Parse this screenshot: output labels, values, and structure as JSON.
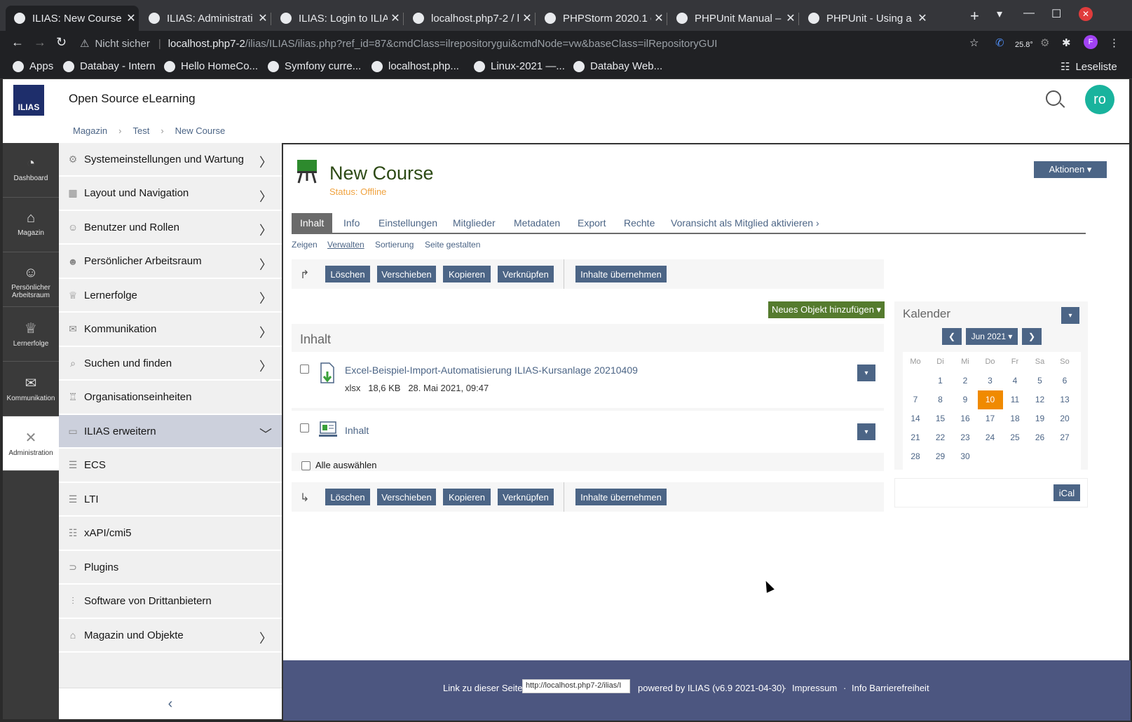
{
  "browser": {
    "tabs": [
      {
        "title": "ILIAS: New Course",
        "active": true
      },
      {
        "title": "ILIAS: Administrati",
        "active": false
      },
      {
        "title": "ILIAS: Login to ILIA",
        "active": false
      },
      {
        "title": "localhost.php7-2 / l",
        "active": false
      },
      {
        "title": "PHPStorm 2020.1 c",
        "active": false
      },
      {
        "title": "PHPUnit Manual – (",
        "active": false
      },
      {
        "title": "PHPUnit - Using a v",
        "active": false
      }
    ],
    "security_label": "Nicht sicher",
    "url_host": "localhost.php7-2",
    "url_rest": "/ilias/ILIAS/ilias.php?ref_id=87&cmdClass=ilrepositorygui&cmdNode=vw&baseClass=ilRepositoryGUI",
    "weather": "25.8°",
    "profile_initial": "F",
    "bookmarks": [
      "Apps",
      "Databay - Intern",
      "Hello HomeCo...",
      "Symfony curre...",
      "localhost.php...",
      "Linux-2021 —...",
      "Databay Web..."
    ],
    "reading_list": "Leseliste"
  },
  "header": {
    "logo_text": "ILIAS",
    "site_title": "Open Source eLearning",
    "avatar_text": "ro"
  },
  "breadcrumb": [
    "Magazin",
    "Test",
    "New Course"
  ],
  "mainbar": [
    {
      "label": "Dashboard",
      "icon": "dashboard-icon",
      "glyph": "◔"
    },
    {
      "label": "Magazin",
      "icon": "repository-icon",
      "glyph": "⌂"
    },
    {
      "label": "Persönlicher Arbeitsraum",
      "icon": "person-icon",
      "glyph": "☺"
    },
    {
      "label": "Lernerfolge",
      "icon": "trophy-icon",
      "glyph": "♕"
    },
    {
      "label": "Kommunikation",
      "icon": "chat-icon",
      "glyph": "✉"
    },
    {
      "label": "Administration",
      "icon": "tools-icon",
      "glyph": "✕",
      "active": true
    }
  ],
  "slate": {
    "items": [
      {
        "label": "Systemeinstellungen und Wartung",
        "glyph": "⚙",
        "chevron": true
      },
      {
        "label": "Layout und Navigation",
        "glyph": "▦",
        "chevron": true
      },
      {
        "label": "Benutzer und Rollen",
        "glyph": "☺",
        "chevron": true
      },
      {
        "label": "Persönlicher Arbeitsraum",
        "glyph": "☻",
        "chevron": true
      },
      {
        "label": "Lernerfolge",
        "glyph": "♕",
        "chevron": true
      },
      {
        "label": "Kommunikation",
        "glyph": "✉",
        "chevron": true
      },
      {
        "label": "Suchen und finden",
        "glyph": "⌕",
        "chevron": true
      },
      {
        "label": "Organisationseinheiten",
        "glyph": "♖",
        "chevron": false
      },
      {
        "label": "ILIAS erweitern",
        "glyph": "▭",
        "chevron": true,
        "expanded": true
      },
      {
        "label": "ECS",
        "glyph": "☰",
        "chevron": false
      },
      {
        "label": "LTI",
        "glyph": "☰",
        "chevron": false
      },
      {
        "label": "xAPI/cmi5",
        "glyph": "☷",
        "chevron": false
      },
      {
        "label": "Plugins",
        "glyph": "⊃",
        "chevron": false
      },
      {
        "label": "Software von Drittanbietern",
        "glyph": "⫶",
        "chevron": false
      },
      {
        "label": "Magazin und Objekte",
        "glyph": "⌂",
        "chevron": true
      }
    ],
    "collapse": "‹"
  },
  "course": {
    "title": "New Course",
    "status": "Status: Offline",
    "actions_label": "Aktionen ▾",
    "tabs": [
      "Inhalt",
      "Info",
      "Einstellungen",
      "Mitglieder",
      "Metadaten",
      "Export",
      "Rechte",
      "Voransicht als Mitglied aktivieren ›"
    ],
    "subtabs": [
      "Zeigen",
      "Verwalten",
      "Sortierung",
      "Seite gestalten"
    ],
    "commands": [
      "Löschen",
      "Verschieben",
      "Kopieren",
      "Verknüpfen",
      "Inhalte übernehmen"
    ],
    "new_object": "Neues Objekt hinzufügen ▾",
    "content_heading": "Inhalt",
    "items": [
      {
        "title": "Excel-Beispiel-Import-Automatisierung ILIAS-Kursanlage 20210409",
        "meta": "xlsx   18,6 KB   28. Mai 2021, 09:47",
        "icon": "file-icon"
      },
      {
        "title": "Inhalt",
        "meta": "",
        "icon": "page-icon"
      }
    ],
    "select_all": "Alle auswählen"
  },
  "calendar": {
    "title": "Kalender",
    "month": "Jun 2021 ▾",
    "weekdays": [
      "Mo",
      "Di",
      "Mi",
      "Do",
      "Fr",
      "Sa",
      "So"
    ],
    "first_weekday_offset": 1,
    "days": 30,
    "today": 10,
    "ical": "iCal"
  },
  "footer": {
    "link_label": "Link zu dieser Seite",
    "link_value": "http://localhost.php7-2/ilias/I",
    "powered": "powered by ILIAS (v6.9 2021-04-30)",
    "imprint": "Impressum",
    "accessibility": "Info Barrierefreiheit"
  }
}
